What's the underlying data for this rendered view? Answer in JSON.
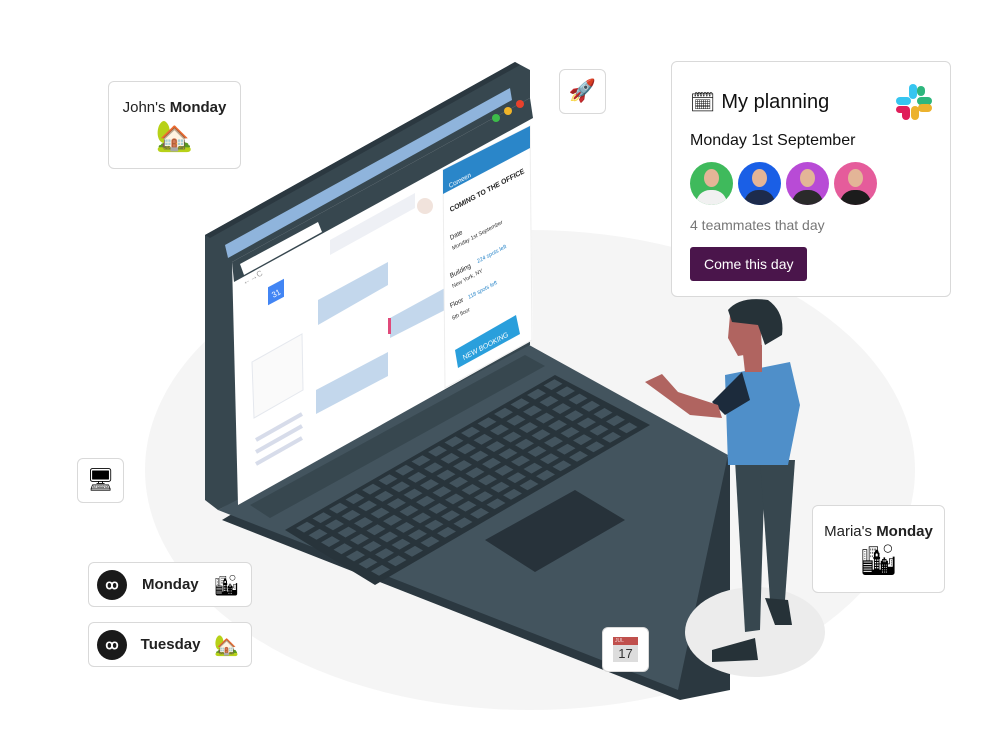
{
  "cards": {
    "johns_monday": {
      "name": "John's",
      "day": "Monday",
      "emoji": "🏡"
    },
    "marias_monday": {
      "name": "Maria's",
      "day": "Monday",
      "emoji": "🏙"
    },
    "rocket_tile": {
      "emoji": "🚀"
    },
    "computer_tile": {
      "emoji": "🖥"
    },
    "calendar_tile": {
      "month": "JUL",
      "day": "17"
    }
  },
  "pills": [
    {
      "day": "Monday",
      "logo": "ꝏ",
      "emoji": "🏙"
    },
    {
      "day": "Tuesday",
      "logo": "ꝏ",
      "emoji": "🏡"
    }
  ],
  "planning": {
    "icon": "🗓",
    "title": "My planning",
    "date": "Monday 1st September",
    "avatars": [
      {
        "bg": "#3fba5c",
        "shirt": "#f1f1f1"
      },
      {
        "bg": "#1a5fe6",
        "shirt": "#1d2b4c"
      },
      {
        "bg": "#b84bd6",
        "shirt": "#2a2a2a"
      },
      {
        "bg": "#e55c9b",
        "shirt": "#1c1c1c"
      }
    ],
    "teammates": "4 teammates that day",
    "button": "Come this day",
    "accent": "#4a154b"
  },
  "laptop_screen": {
    "panel_brand": "Comeen",
    "panel_title": "COMING TO THE OFFICE",
    "date_label": "Date",
    "date_value": "Monday 1st September",
    "building_label": "Building",
    "building_spots": "224 spots left",
    "building_value": "New York, NY",
    "floor_label": "Floor",
    "floor_spots": "118 spots left",
    "floor_value": "6th floor",
    "booking_button": "NEW BOOKING",
    "calendar_icon": "31",
    "accent": "#2a86c9"
  }
}
